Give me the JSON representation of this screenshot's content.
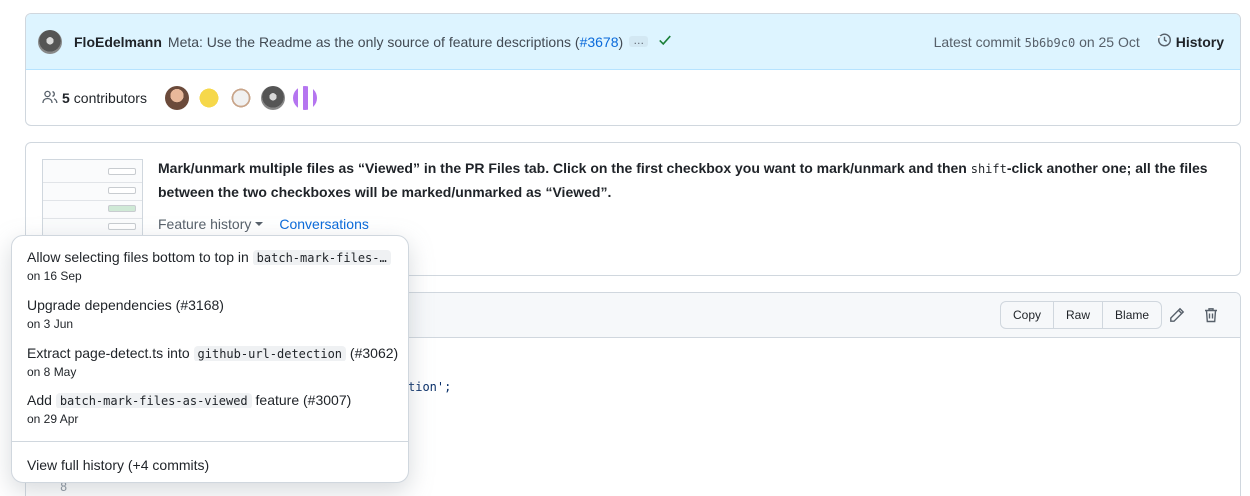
{
  "commit": {
    "author": "FloEdelmann",
    "message": "Meta: Use the Readme as the only source of feature descriptions",
    "pr_open": "(",
    "pr_link": "#3678",
    "pr_close": ")",
    "ellipsis": "…",
    "latest_label": "Latest commit",
    "sha": "5b6b9c0",
    "date": "on 25 Oct",
    "history_label": "History"
  },
  "contributors": {
    "count": "5",
    "label": "contributors"
  },
  "feature": {
    "text_part1": "Mark/unmark multiple files as “Viewed” in the PR Files tab. Click on the first checkbox you want to mark/unmark and then ",
    "text_code": "shift",
    "text_part2": "-click another one; all the files between the two checkboxes will be marked/unmarked as “Viewed”.",
    "history_label": "Feature history",
    "conversations_label": "Conversations"
  },
  "file": {
    "copy_label": "Copy",
    "raw_label": "Raw",
    "blame_label": "Blame",
    "code_fragment": "tion';",
    "line_8": "8"
  },
  "dropdown": {
    "items": [
      {
        "prefix": "Allow selecting files bottom to top in ",
        "code": "batch-mark-files-…",
        "suffix": "",
        "date": "on 16 Sep"
      },
      {
        "prefix": "Upgrade dependencies (#3168)",
        "code": "",
        "suffix": "",
        "date": "on 3 Jun"
      },
      {
        "prefix": "Extract page-detect.ts into ",
        "code": "github-url-detection",
        "suffix": " (#3062)",
        "date": "on 8 May"
      },
      {
        "prefix": "Add ",
        "code": "batch-mark-files-as-viewed",
        "suffix": " feature (#3007)",
        "date": "on 29 Apr"
      }
    ],
    "full_history": "View full history (+4 commits)"
  },
  "icons": {
    "check": "check-icon",
    "history": "history-icon",
    "people": "people-icon",
    "pencil": "pencil-icon",
    "trash": "trash-icon"
  },
  "colors": {
    "accent": "#0969da",
    "success": "#1a7f37",
    "header_bg": "#ddf4ff"
  }
}
